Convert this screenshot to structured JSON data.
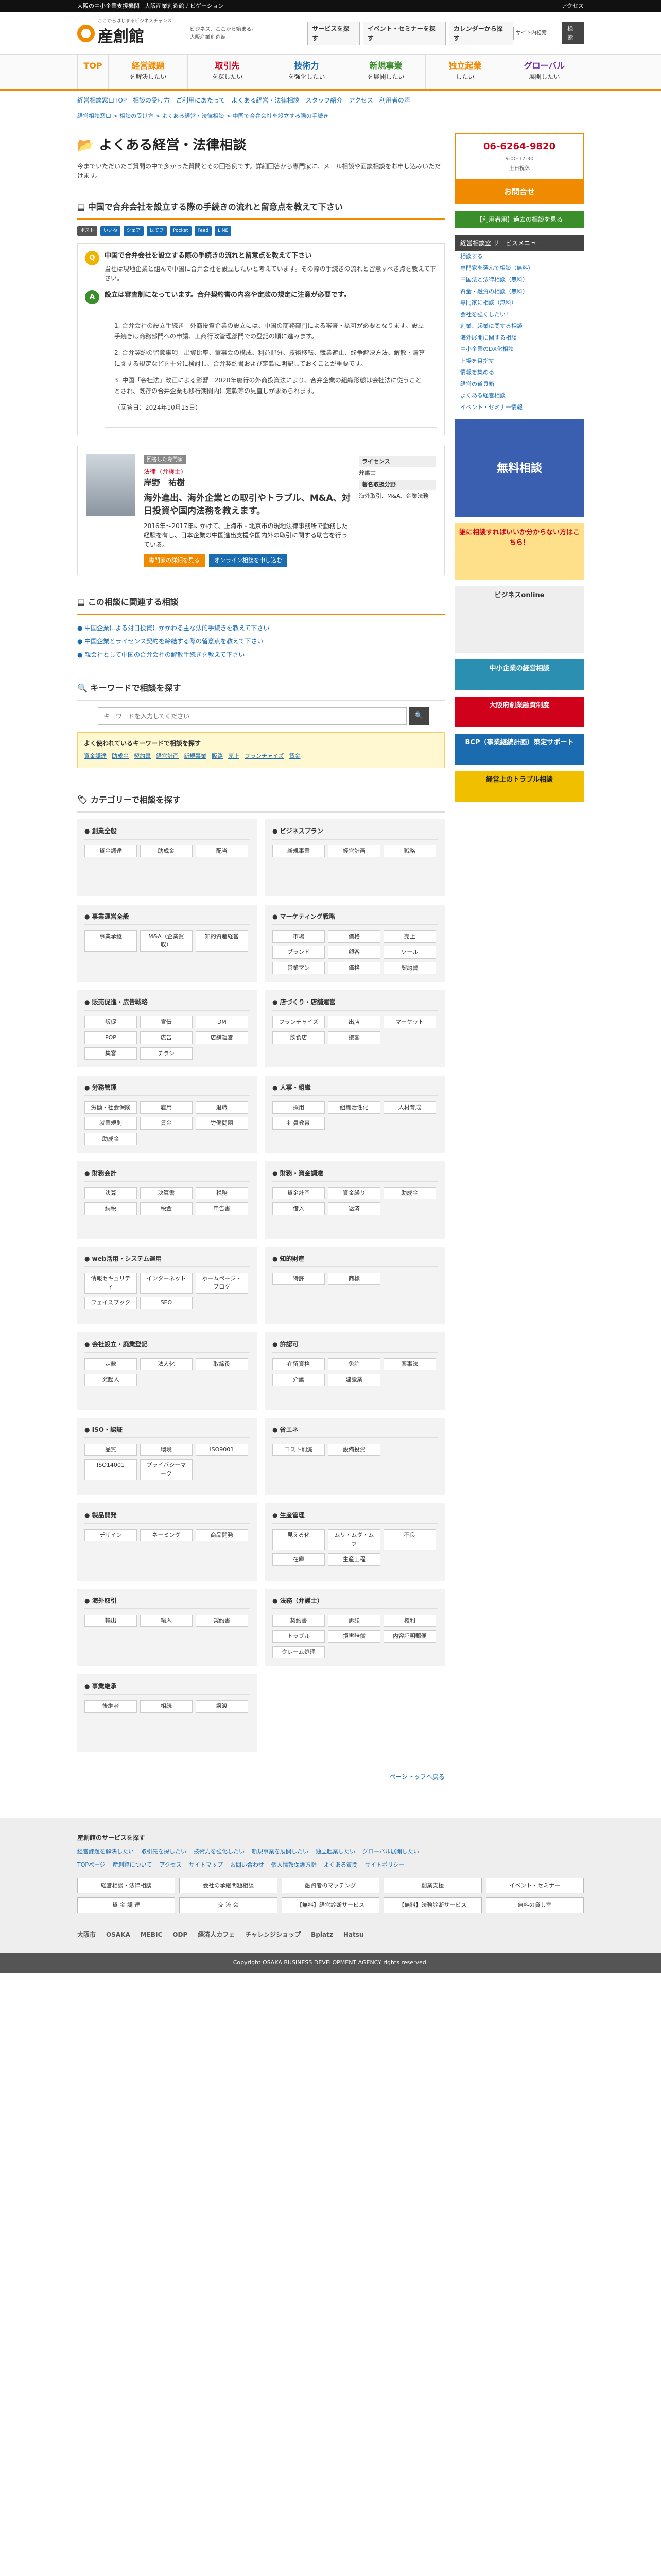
{
  "topbar": {
    "left": "大阪の中小企業支援機関",
    "mid": "大阪産業創造館ナビゲーション",
    "right": "アクセス"
  },
  "header": {
    "logo_small": "ここからはじまるビジネスチャンス",
    "logo": "産創館",
    "tagline": "ビジネス、ここから始まる。",
    "tagline2": "大阪産業創造館",
    "s1": "サービスを探す",
    "s2": "イベント・セミナーを探す",
    "s3": "カレンダーから探す",
    "search_label": "サイト内検索",
    "search_btn": "検索"
  },
  "gnav": [
    {
      "t": "TOP",
      "s": ""
    },
    {
      "t": "経営課題",
      "s": "を解決したい"
    },
    {
      "t": "取引先",
      "s": "を探したい"
    },
    {
      "t": "技術力",
      "s": "を強化したい"
    },
    {
      "t": "新規事業",
      "s": "を展開したい"
    },
    {
      "t": "独立起業",
      "s": "したい"
    },
    {
      "t": "グローバル",
      "s": "展開したい"
    }
  ],
  "subnav": [
    "経営相談窓口TOP",
    "相談の受け方",
    "ご利用にあたって",
    "よくある経営・法律相談",
    "スタッフ紹介",
    "アクセス",
    "利用者の声"
  ],
  "breadcrumb": "経営相談窓口 > 相談の受け方 > よくある経営・法律相談 > 中国で合弁会社を設立する際の手続き",
  "h1": "よくある経営・法律相談",
  "lead": "今までいただいたご質問の中で多かった質問とその回答例です。詳細回答から専門家に、メール相談や面談相談をお申し込みいただけます。",
  "h2": "中国で合弁会社を設立する際の手続きの流れと留意点を教えて下さい",
  "share": [
    "ポスト",
    "いいね",
    "シェア",
    "はてブ",
    "Pocket",
    "Feed",
    "LINE"
  ],
  "q": {
    "title": "中国で合弁会社を設立する際の手続きの流れと留意点を教えて下さい",
    "sub": "当社は現地企業と組んで中国に合弁会社を設立したいと考えています。その際の手続きの流れと留意すべき点を教えて下さい。"
  },
  "a": {
    "title": "設立は審査制になっています。合弁契約書の内容や定款の規定に注意が必要です。",
    "p": [
      "1. 合弁会社の設立手続き　外商投資企業の設立には、中国の商務部門による審査・認可が必要となります。設立手続きは商務部門への申請、工商行政管理部門での登記の順に進みます。",
      "2. 合弁契約の留意事項　出資比率、董事会の構成、利益配分、技術移転、競業避止、紛争解決方法、解散・清算に関する規定などを十分に検討し、合弁契約書および定款に明記しておくことが重要です。",
      "3. 中国「会社法」改正による影響　2020年施行の外商投資法により、合弁企業の組織形態は会社法に従うこととされ、既存の合弁企業も移行期間内に定款等の見直しが求められます。",
      "（回答日：2024年10月15日）"
    ]
  },
  "pro": {
    "tag": "回答した専門家",
    "role": "法律（弁護士）",
    "name": "岸野　祐樹",
    "title": "海外進出、海外企業との取引やトラブル、M&A、対日投資や国内法務を教えます。",
    "desc": "2016年〜2017年にかけて、上海市・北京市の現地法律事務所で勤務した経験を有し、日本企業の中国進出支援や国内外の取引に関する助言を行っている。",
    "lic_h": "ライセンス",
    "lic": "弁護士",
    "area_h": "著名取扱分野",
    "area": "海外取引、M&A、企業法務",
    "btn1": "専門家の詳細を見る",
    "btn2": "オンライン相談を申し込む"
  },
  "related": {
    "h": "この相談に関連する相談",
    "items": [
      "中国企業による対日投資にかかわる主な法的手続きを教えて下さい",
      "中国企業とライセンス契約を締結する際の留意点を教えて下さい",
      "親会社として中国の合弁会社の解散手続きを教えて下さい"
    ]
  },
  "kw": {
    "h": "キーワードで相談を探す",
    "placeholder": "キーワードを入力してください",
    "btn": "🔍",
    "box_h": "よく使われているキーワードで相談を探す",
    "tags": [
      "資金調達",
      "助成金",
      "契約書",
      "経営計画",
      "新規事業",
      "販路",
      "売上",
      "フランチャイズ",
      "賃金"
    ]
  },
  "cat_h": "カテゴリーで相談を探す",
  "cats": [
    {
      "h": "創業全般",
      "c": [
        "資金調達",
        "助成金",
        "配当"
      ]
    },
    {
      "h": "ビジネスプラン",
      "c": [
        "新規事業",
        "経営計画",
        "戦略"
      ]
    },
    {
      "h": "事業運営全般",
      "c": [
        "事業承継",
        "M&A（企業買収）",
        "知的資産経営"
      ]
    },
    {
      "h": "マーケティング戦略",
      "c": [
        "市場",
        "価格",
        "売上",
        "ブランド",
        "顧客",
        "ツール",
        "営業マン",
        "価格",
        "契約書"
      ]
    },
    {
      "h": "販売促進・広告戦略",
      "c": [
        "販促",
        "宣伝",
        "DM",
        "POP",
        "広告",
        "店舗運営",
        "集客",
        "チラシ"
      ]
    },
    {
      "h": "店づくり・店舗運営",
      "c": [
        "フランチャイズ",
        "出店",
        "マーケット",
        "飲食店",
        "接客"
      ]
    },
    {
      "h": "労務管理",
      "c": [
        "労働・社会保険",
        "雇用",
        "退職",
        "就業規則",
        "賃金",
        "労働問題",
        "助成金"
      ]
    },
    {
      "h": "人事・組織",
      "c": [
        "採用",
        "組織活性化",
        "人材育成",
        "社員教育"
      ]
    },
    {
      "h": "財務会計",
      "c": [
        "決算",
        "決算書",
        "税務",
        "納税",
        "税金",
        "申告書"
      ]
    },
    {
      "h": "財務・資金調達",
      "c": [
        "資金計画",
        "資金繰り",
        "助成金",
        "借入",
        "返済"
      ]
    },
    {
      "h": "web活用・システム運用",
      "c": [
        "情報セキュリティ",
        "インターネット",
        "ホームページ・ブログ",
        "フェイスブック",
        "SEO"
      ]
    },
    {
      "h": "知的財産",
      "c": [
        "特許",
        "商標"
      ]
    },
    {
      "h": "会社設立・廃業登記",
      "c": [
        "定款",
        "法人化",
        "取締役",
        "発起人"
      ]
    },
    {
      "h": "許認可",
      "c": [
        "在留資格",
        "免許",
        "薬事法",
        "介護",
        "建設業"
      ]
    },
    {
      "h": "ISO・認証",
      "c": [
        "品質",
        "環境",
        "ISO9001",
        "ISO14001",
        "プライバシーマーク"
      ]
    },
    {
      "h": "省エネ",
      "c": [
        "コスト削減",
        "設備投資"
      ]
    },
    {
      "h": "製品開発",
      "c": [
        "デザイン",
        "ネーミング",
        "商品開発"
      ]
    },
    {
      "h": "生産管理",
      "c": [
        "見える化",
        "ムリ・ムダ・ムラ",
        "不良",
        "在庫",
        "生産工程"
      ]
    },
    {
      "h": "海外取引",
      "c": [
        "輸出",
        "輸入",
        "契約書"
      ]
    },
    {
      "h": "法務（弁護士）",
      "c": [
        "契約書",
        "訴訟",
        "権利",
        "トラブル",
        "損害賠償",
        "内容証明郵便",
        "クレーム処理"
      ]
    },
    {
      "h": "事業継承",
      "c": [
        "後継者",
        "相続",
        "譲渡"
      ]
    }
  ],
  "pagetop": "ページトップへ戻る",
  "side": {
    "phone": "06-6264-9820",
    "hours": "9:00-17:30",
    "note": "土日祝休",
    "cta": "お問合せ",
    "green": "【利用者用】過去の相談を見る",
    "menu_h": "経営相談室 サービスメニュー",
    "menu": [
      "相談する",
      "専門家を選んで相談（無料）",
      "中国法と法律相談（無料）",
      "資金・融資の相談（無料）",
      "専門家に相談（無料）",
      "会社を強くしたい！",
      "創業、起業に関する相談",
      "海外展開に関する相談",
      "中小企業のDX化相談",
      "上場を目指す",
      "情報を集める",
      "経営の道具箱",
      "よくある経営相談",
      "イベント・セミナー情報"
    ],
    "banners": [
      "無料相談",
      "誰に相談すればいいか分からない方はこちら！",
      "ビジネスonline",
      "中小企業の経営相談",
      "大阪府創業融資制度",
      "BCP（事業継続計画）策定サポート",
      "経営上のトラブル相談"
    ]
  },
  "footer": {
    "h": "産創館のサービスを探す",
    "links": [
      "経営課題を解決したい",
      "取引先を探したい",
      "技術力を強化したい",
      "新規事業を展開したい",
      "独立起業したい",
      "グローバル展開したい"
    ],
    "nav": [
      "TOPページ",
      "産創館について",
      "アクセス",
      "サイトマップ",
      "お問い合わせ",
      "個人情報保護方針",
      "よくある質問",
      "サイトポリシー"
    ],
    "grid": [
      "経営相談・法律相談",
      "会社の承継問題相談",
      "融資者のマッチング",
      "創業支援",
      "イベント・セミナー",
      "資 金 調 達",
      "交 流 会",
      "【無料】経営診断サービス",
      "【無料】法務診断サービス",
      "無料の貸し室"
    ],
    "logos": [
      "大阪市",
      "OSAKA",
      "MEBIC",
      "ODP",
      "経済人カフェ",
      "チャレンジショップ",
      "Bplatz",
      "Hatsu"
    ]
  },
  "copy": "Copyright OSAKA BUSINESS DEVELOPMENT AGENCY rights reserved."
}
